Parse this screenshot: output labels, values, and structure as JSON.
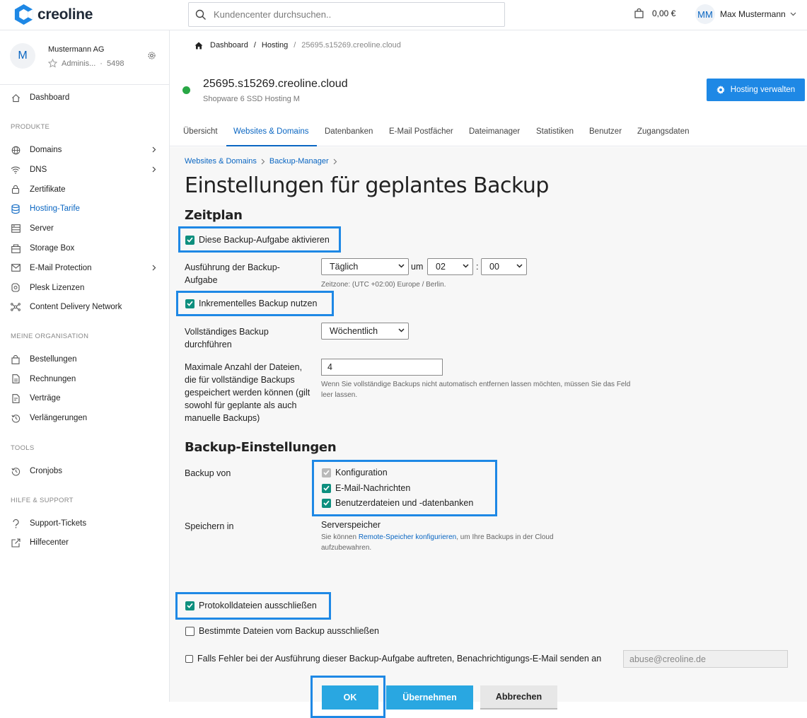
{
  "topbar": {
    "logo_text": "creoline",
    "search_placeholder": "Kundencenter durchsuchen..",
    "cart_amount": "0,00 €",
    "user_initials": "MM",
    "user_name": "Max Mustermann"
  },
  "sidebar": {
    "org": {
      "initial": "M",
      "name": "Mustermann AG",
      "role": "Adminis...",
      "sep": "·",
      "number": "5498"
    },
    "dashboard": "Dashboard",
    "section_products": "PRODUKTE",
    "products": [
      {
        "label": "Domains",
        "icon": "globe-icon",
        "has_arrow": true
      },
      {
        "label": "DNS",
        "icon": "wifi-icon",
        "has_arrow": true
      },
      {
        "label": "Zertifikate",
        "icon": "lock-icon",
        "has_arrow": false
      },
      {
        "label": "Hosting-Tarife",
        "icon": "database-icon",
        "has_arrow": false,
        "active": true
      },
      {
        "label": "Server",
        "icon": "server-icon",
        "has_arrow": false
      },
      {
        "label": "Storage Box",
        "icon": "storage-box-icon",
        "has_arrow": false
      },
      {
        "label": "E-Mail Protection",
        "icon": "mail-icon",
        "has_arrow": true
      },
      {
        "label": "Plesk Lizenzen",
        "icon": "plesk-icon",
        "has_arrow": false
      },
      {
        "label": "Content Delivery Network",
        "icon": "network-icon",
        "has_arrow": false
      }
    ],
    "section_org": "MEINE ORGANISATION",
    "org_items": [
      {
        "label": "Bestellungen",
        "icon": "bag-icon"
      },
      {
        "label": "Rechnungen",
        "icon": "invoice-icon"
      },
      {
        "label": "Verträge",
        "icon": "contract-icon"
      },
      {
        "label": "Verlängerungen",
        "icon": "history-icon"
      }
    ],
    "section_tools": "TOOLS",
    "tools": [
      {
        "label": "Cronjobs",
        "icon": "history-icon"
      }
    ],
    "section_help": "HILFE & SUPPORT",
    "help_items": [
      {
        "label": "Support-Tickets",
        "icon": "question-icon"
      },
      {
        "label": "Hilfecenter",
        "icon": "external-link-icon"
      }
    ]
  },
  "breadcrumb": {
    "home": "Dashboard",
    "sep": "/",
    "hosting": "Hosting",
    "current": "25695.s15269.creoline.cloud"
  },
  "host": {
    "title": "25695.s15269.creoline.cloud",
    "subtitle": "Shopware 6 SSD Hosting M",
    "manage_button": "Hosting verwalten",
    "status_color": "#28a745"
  },
  "tabs": [
    "Übersicht",
    "Websites & Domains",
    "Datenbanken",
    "E-Mail Postfächer",
    "Dateimanager",
    "Statistiken",
    "Benutzer",
    "Zugangsdaten"
  ],
  "active_tab": "Websites & Domains",
  "plesk": {
    "crumbs": [
      "Websites & Domains",
      "Backup-Manager"
    ],
    "title": "Einstellungen für geplantes Backup",
    "schedule_heading": "Zeitplan",
    "activate_label": "Diese Backup-Aufgabe aktivieren",
    "execution_label": "Ausführung der Backup-Aufgabe",
    "frequency": "Täglich",
    "at_word": "um",
    "hour": "02",
    "colon": ":",
    "minute": "00",
    "timezone": "Zeitzone: (UTC +02:00) Europe / Berlin.",
    "incremental_label": "Inkrementelles Backup nutzen",
    "full_backup_label": "Vollständiges Backup durchführen",
    "full_backup_value": "Wöchentlich",
    "max_files_label": "Maximale Anzahl der Dateien, die für vollständige Backups gespeichert werden können (gilt sowohl für geplante als auch manuelle Backups)",
    "max_files_value": "4",
    "max_files_help": "Wenn Sie vollständige Backups nicht automatisch entfernen lassen möchten, müssen Sie das Feld leer lassen.",
    "settings_heading": "Backup-Einstellungen",
    "backup_of_label": "Backup von",
    "backup_items": [
      "Konfiguration",
      "E-Mail-Nachrichten",
      "Benutzerdateien und -datenbanken"
    ],
    "store_in_label": "Speichern in",
    "store_in_value": "Serverspeicher",
    "store_help_pre": "Sie können ",
    "store_help_link": "Remote-Speicher konfigurieren",
    "store_help_post": ", um Ihre Backups in der Cloud aufzubewahren.",
    "exclude_logs_label": "Protokolldateien ausschließen",
    "exclude_files_label": "Bestimmte Dateien vom Backup ausschließen",
    "notify_label": "Falls Fehler bei der Ausführung dieser Backup-Aufgabe auftreten, Benachrichtigungs-E-Mail senden an",
    "notify_email": "abuse@creoline.de",
    "ok_button": "OK",
    "apply_button": "Übernehmen",
    "cancel_button": "Abbrechen"
  }
}
